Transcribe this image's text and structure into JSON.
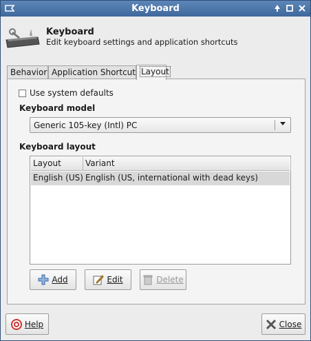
{
  "window": {
    "title": "Keyboard"
  },
  "header": {
    "title": "Keyboard",
    "subtitle": "Edit keyboard settings and application shortcuts"
  },
  "tabs": [
    {
      "label": "Behavior",
      "active": false
    },
    {
      "label": "Application Shortcuts",
      "active": false
    },
    {
      "label": "Layout",
      "active": true
    }
  ],
  "layout": {
    "use_system_defaults": {
      "label": "Use system defaults",
      "checked": false
    },
    "keyboard_model": {
      "heading": "Keyboard model",
      "value": "Generic 105-key (Intl) PC"
    },
    "keyboard_layout": {
      "heading": "Keyboard layout",
      "columns": [
        "Layout",
        "Variant"
      ],
      "rows": [
        {
          "layout": "English (US)",
          "variant": "English (US, international with dead keys)"
        }
      ]
    },
    "buttons": {
      "add": "Add",
      "edit": "Edit",
      "delete": "Delete"
    }
  },
  "footer": {
    "help": "Help",
    "close": "Close"
  },
  "colors": {
    "titlebar": "#4a74a8",
    "selected_row": "#d8d8d8"
  }
}
